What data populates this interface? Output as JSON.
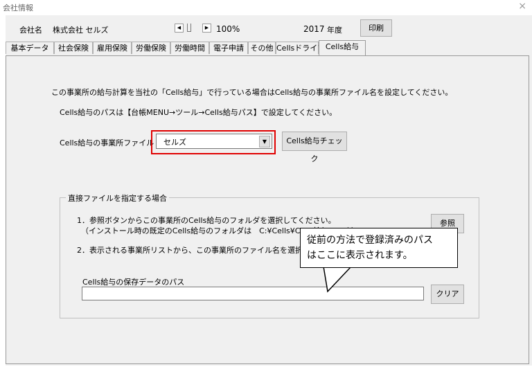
{
  "window": {
    "title": "会社情報",
    "close_glyph": "×"
  },
  "header": {
    "company_label": "会社名",
    "company_name": "株式会社 セルズ",
    "zoom": "100%",
    "year": "2017",
    "year_unit": "年度",
    "print_button": "印刷"
  },
  "tabs": [
    {
      "label": "基本データ"
    },
    {
      "label": "社会保険"
    },
    {
      "label": "雇用保険"
    },
    {
      "label": "労働保険"
    },
    {
      "label": "労働時間"
    },
    {
      "label": "電子申請"
    },
    {
      "label": "その他"
    },
    {
      "label": "Cellsドライブ"
    },
    {
      "label": "Cells給与"
    }
  ],
  "active_tab": "Cells給与",
  "main": {
    "info_line1": "この事業所の給与計算を当社の「Cells給与」で行っている場合はCells給与の事業所ファイル名を設定してください。",
    "info_line2": "Cells給与のパスは【台帳MENU→ツール→Cells給与パス】で設定してください。",
    "office_file_label": "Cells給与の事業所ファイル",
    "office_file_value": "セルズ",
    "check_button": "Cells給与チェック"
  },
  "group": {
    "title": "直接ファイルを指定する場合",
    "step1_line1": "1．参照ボタンからこの事業所のCells給与のフォルダを選択してください。",
    "step1_line2": "（インストール時の既定のCells給与のフォルダは　C:¥Cells¥Cells給与　です）",
    "step2": "2．表示される事業所リストから、この事業所のファイル名を選択して登録してください。",
    "browse_button": "参照",
    "path_label": "Cells給与の保存データのパス",
    "path_value": "",
    "clear_button": "クリア"
  },
  "callout": {
    "line1": "従前の方法で登録済みのパス",
    "line2": "はここに表示されます。"
  },
  "colors": {
    "highlight": "#e00000",
    "panel": "#f0f0f0"
  }
}
